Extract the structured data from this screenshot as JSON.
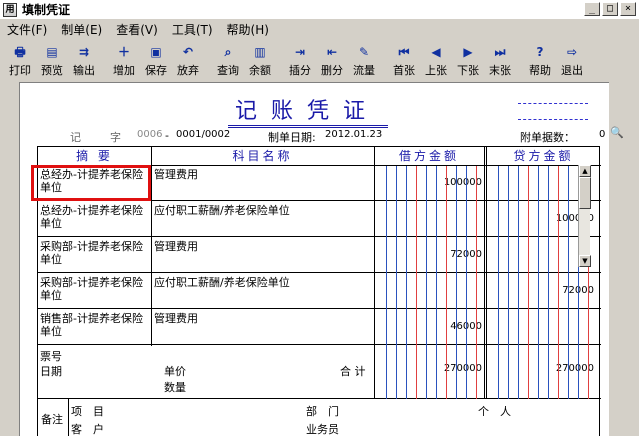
{
  "window": {
    "title": "填制凭证",
    "app_icon": "用"
  },
  "menu": [
    "文件(F)",
    "制单(E)",
    "查看(V)",
    "工具(T)",
    "帮助(H)"
  ],
  "toolbar": [
    {
      "label": "打印",
      "icon": "🖶"
    },
    {
      "label": "预览",
      "icon": "▤"
    },
    {
      "label": "输出",
      "icon": "⇉"
    },
    {
      "label": "增加",
      "icon": "＋"
    },
    {
      "label": "保存",
      "icon": "▣"
    },
    {
      "label": "放弃",
      "icon": "↶"
    },
    {
      "label": "查询",
      "icon": "⌕"
    },
    {
      "label": "余额",
      "icon": "▥"
    },
    {
      "label": "插分",
      "icon": "⇥"
    },
    {
      "label": "删分",
      "icon": "⇤"
    },
    {
      "label": "流量",
      "icon": "✎"
    },
    {
      "label": "首张",
      "icon": "⏮"
    },
    {
      "label": "上张",
      "icon": "◀"
    },
    {
      "label": "下张",
      "icon": "▶"
    },
    {
      "label": "末张",
      "icon": "⏭"
    },
    {
      "label": "帮助",
      "icon": "?"
    },
    {
      "label": "退出",
      "icon": "⇨"
    }
  ],
  "voucher": {
    "title": "记账凭证",
    "type": "记",
    "zi": "字",
    "number": "0006",
    "sep": "-",
    "page": "0001/0002",
    "date_label": "制单日期:",
    "date": "2012.01.23",
    "attach_label": "附单据数：",
    "attach_count": "0",
    "headers": {
      "summary": "摘 要",
      "account": "科目名称",
      "debit": "借方金额",
      "credit": "贷方金额"
    },
    "rows": [
      {
        "summary": "总经办-计提养老保险单位",
        "account": "管理费用",
        "debit": "100000",
        "credit": ""
      },
      {
        "summary": "总经办-计提养老保险单位",
        "account": "应付职工薪酬/养老保险单位",
        "debit": "",
        "credit": "100000"
      },
      {
        "summary": "采购部-计提养老保险单位",
        "account": "管理费用",
        "debit": "72000",
        "credit": ""
      },
      {
        "summary": "采购部-计提养老保险单位",
        "account": "应付职工薪酬/养老保险单位",
        "debit": "",
        "credit": "72000"
      },
      {
        "summary": "销售部-计提养老保险单位",
        "account": "管理费用",
        "debit": "46000",
        "credit": ""
      }
    ],
    "footer": {
      "bill_no": "票号",
      "date": "日期",
      "unit_price": "单价",
      "quantity": "数量",
      "total": "合 计",
      "total_debit": "270000",
      "total_credit": "270000",
      "note": "备注",
      "project": "项　目",
      "dept": "部　门",
      "person": "个　人",
      "customer": "客　户",
      "salesman": "业务员"
    }
  }
}
